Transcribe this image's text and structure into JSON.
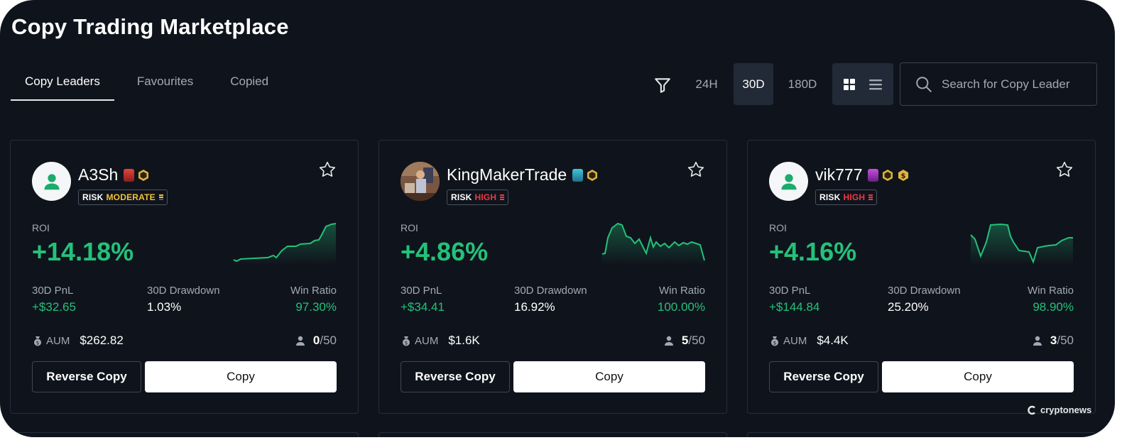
{
  "page": {
    "title": "Copy Trading Marketplace"
  },
  "tabs": [
    {
      "label": "Copy Leaders",
      "active": true
    },
    {
      "label": "Favourites",
      "active": false
    },
    {
      "label": "Copied",
      "active": false
    }
  ],
  "toolbar": {
    "filter_icon": "filter-icon",
    "periods": [
      {
        "label": "24H",
        "active": false
      },
      {
        "label": "30D",
        "active": true
      },
      {
        "label": "180D",
        "active": false
      }
    ],
    "view": {
      "grid_icon": "grid-view-icon",
      "list_icon": "list-view-icon",
      "active": "grid"
    },
    "search": {
      "placeholder": "Search for Copy Leader",
      "value": ""
    }
  },
  "labels": {
    "roi": "ROI",
    "pnl": "30D PnL",
    "drawdown": "30D Drawdown",
    "win_ratio": "Win Ratio",
    "aum": "AUM",
    "risk": "RISK",
    "reverse_copy": "Reverse Copy",
    "copy": "Copy"
  },
  "leaders": [
    {
      "name": "A3Sh",
      "avatar": "default-user-icon",
      "risk_level": "MODERATE",
      "roi": "+14.18%",
      "pnl": "+$32.65",
      "drawdown": "1.03%",
      "win_ratio": "97.30%",
      "aum": "$262.82",
      "copiers": "0",
      "copiers_max": "/50",
      "favourite": false
    },
    {
      "name": "KingMakerTrade",
      "avatar": "profile-photo",
      "risk_level": "HIGH",
      "roi": "+4.86%",
      "pnl": "+$34.41",
      "drawdown": "16.92%",
      "win_ratio": "100.00%",
      "aum": "$1.6K",
      "copiers": "5",
      "copiers_max": "/50",
      "favourite": false
    },
    {
      "name": "vik777",
      "avatar": "default-user-icon",
      "risk_level": "HIGH",
      "roi": "+4.16%",
      "pnl": "+$144.84",
      "drawdown": "25.20%",
      "win_ratio": "98.90%",
      "aum": "$4.4K",
      "copiers": "3",
      "copiers_max": "/50",
      "favourite": false
    }
  ],
  "watermark": "cryptonews",
  "colors": {
    "background": "#0f141c",
    "positive": "#24c17a",
    "risk_moderate": "#f3c13a",
    "risk_high": "#f23645",
    "active_chip": "#212a36"
  }
}
